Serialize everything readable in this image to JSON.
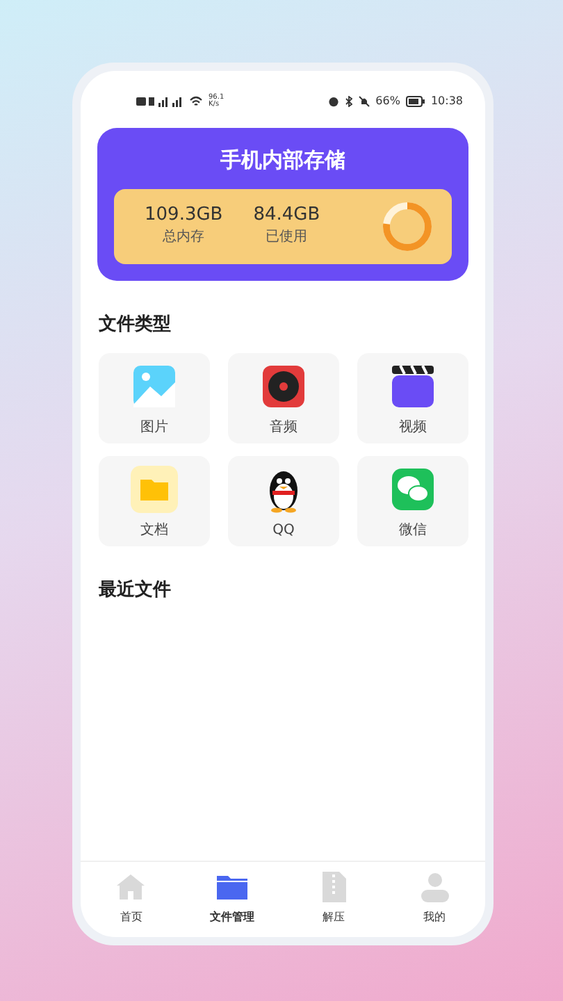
{
  "status_bar": {
    "net_speed": "96.1 K/s",
    "battery": "66%",
    "time": "10:38"
  },
  "storage": {
    "title": "手机内部存储",
    "total": "109.3GB",
    "total_label": "总内存",
    "used": "84.4GB",
    "used_label": "已使用",
    "level": 0.77
  },
  "file_types": {
    "title": "文件类型",
    "items": [
      {
        "kind": "image",
        "label": "图片"
      },
      {
        "kind": "audio",
        "label": "音频"
      },
      {
        "kind": "video",
        "label": "视频"
      },
      {
        "kind": "document",
        "label": "文档"
      },
      {
        "kind": "qq",
        "label": "QQ"
      },
      {
        "kind": "wechat",
        "label": "微信"
      }
    ]
  },
  "recent": {
    "title": "最近文件"
  },
  "tab_bar": [
    {
      "kind": "home",
      "label": "首页",
      "selected": false
    },
    {
      "kind": "files",
      "label": "文件管理",
      "selected": true
    },
    {
      "kind": "unzip",
      "label": "解压",
      "selected": false
    },
    {
      "kind": "me",
      "label": "我的",
      "selected": false
    }
  ]
}
